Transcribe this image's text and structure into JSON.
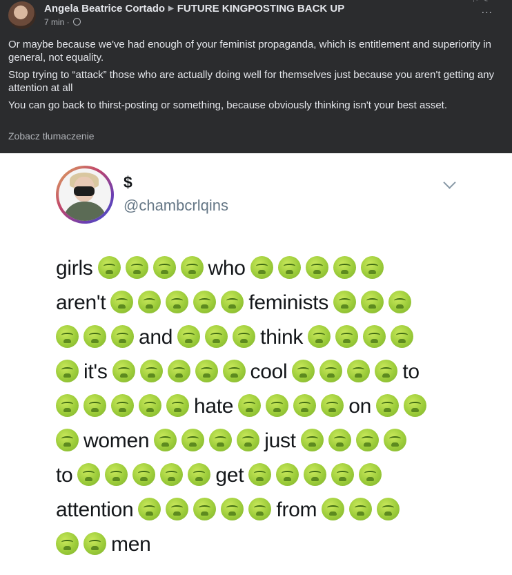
{
  "post": {
    "author": "Angela Beatrice Cortado",
    "group": "FUTURE KINGPOSTING BACK UP",
    "time": "7 min",
    "more_label": "...",
    "comment_paragraphs": [
      "Or maybe because we've had enough of your feminist propaganda, which is entitlement and superiority in general, not equality.",
      "Stop trying to “attack” those who are actually doing well for themselves just because you aren't getting any attention at all",
      "You can go back to thirst-posting or something, because obviously thinking isn't your best asset."
    ],
    "translate_label": "Zobacz tłumaczenie"
  },
  "tweet": {
    "name": "$",
    "handle": "@chambcrlqins",
    "emoji_icon": "nauseated-face-icon",
    "emoji_color": "#9ccc3a",
    "lines": [
      [
        {
          "t": "girls"
        },
        {
          "e": 4
        },
        {
          "t": "who"
        },
        {
          "e": 5
        }
      ],
      [
        {
          "t": "aren't"
        },
        {
          "e": 5
        },
        {
          "t": "feminists"
        },
        {
          "e": 3
        }
      ],
      [
        {
          "e": 3
        },
        {
          "t": "and"
        },
        {
          "e": 3
        },
        {
          "t": "think"
        },
        {
          "e": 4
        }
      ],
      [
        {
          "e": 1
        },
        {
          "t": "it's"
        },
        {
          "e": 5
        },
        {
          "t": "cool"
        },
        {
          "e": 4
        },
        {
          "t": "to"
        }
      ],
      [
        {
          "e": 5
        },
        {
          "t": "hate"
        },
        {
          "e": 4
        },
        {
          "t": "on"
        },
        {
          "e": 2
        }
      ],
      [
        {
          "e": 1
        },
        {
          "t": "women"
        },
        {
          "e": 4
        },
        {
          "t": "just"
        },
        {
          "e": 4
        }
      ],
      [
        {
          "t": "to"
        },
        {
          "e": 5
        },
        {
          "t": "get"
        },
        {
          "e": 5
        }
      ],
      [
        {
          "t": "attention"
        },
        {
          "e": 5
        },
        {
          "t": "from"
        },
        {
          "e": 3
        }
      ],
      [
        {
          "e": 2
        },
        {
          "t": "men"
        }
      ]
    ]
  }
}
